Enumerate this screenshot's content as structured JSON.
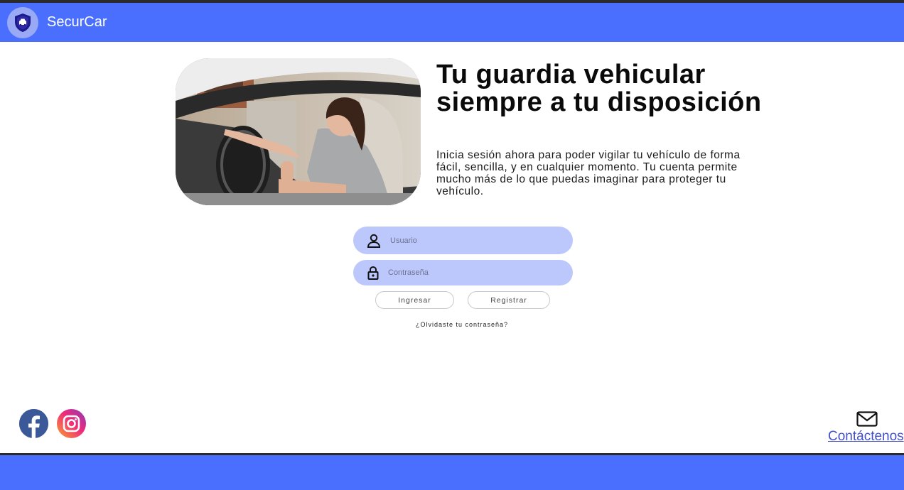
{
  "navbar": {
    "brand": "SecurCar",
    "logo_icon": "shield-car-icon"
  },
  "hero": {
    "headline": "Tu guardia vehicular siempre a tu disposición",
    "description": "Inicia sesión ahora para poder vigilar tu vehículo de forma fácil, sencilla, y en cualquier momento. Tu cuenta permite mucho más de lo que puedas imaginar para proteger tu vehículo."
  },
  "login": {
    "user_placeholder": "Usuario",
    "password_placeholder": "Contraseña",
    "login_label": "Ingresar",
    "register_label": "Registrar",
    "forgot_label": "¿Olvidaste tu contraseña?"
  },
  "footer": {
    "contact_label": "Contáctenos"
  },
  "colors": {
    "primary": "#4a6fff",
    "field_bg": "#bcc8fb",
    "link": "#4450c8"
  }
}
